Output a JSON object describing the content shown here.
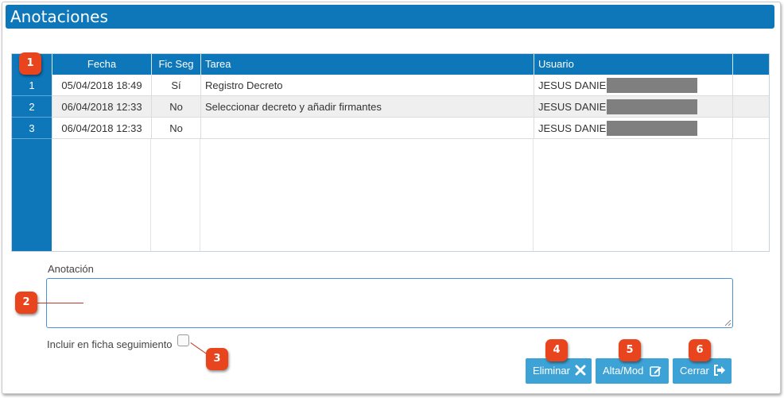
{
  "window": {
    "title": "Anotaciones"
  },
  "grid": {
    "columns": [
      "Fecha",
      "Fic Seg",
      "Tarea",
      "Usuario"
    ],
    "rows": [
      {
        "num": "1",
        "fecha": "05/04/2018 18:49",
        "fic_seg": "Sí",
        "tarea": "Registro Decreto",
        "usuario": "JESUS DANIEL"
      },
      {
        "num": "2",
        "fecha": "06/04/2018 12:33",
        "fic_seg": "No",
        "tarea": "Seleccionar decreto y añadir firmantes",
        "usuario": "JESUS DANIEL"
      },
      {
        "num": "3",
        "fecha": "06/04/2018 12:33",
        "fic_seg": "No",
        "tarea": "",
        "usuario": "JESUS DANIEL"
      }
    ]
  },
  "form": {
    "annotation_label": "Anotación",
    "annotation_value": "",
    "include_label": "Incluir en ficha seguimiento",
    "include_checked": false
  },
  "buttons": {
    "delete_label": "Eliminar",
    "save_label": "Alta/Mod",
    "close_label": "Cerrar"
  },
  "callouts": [
    "1",
    "2",
    "3",
    "4",
    "5",
    "6"
  ],
  "colors": {
    "primary": "#0d77b9",
    "button": "#3da3d6",
    "callout": "#e8441d",
    "redaction": "#7f7f7f"
  },
  "icons": {
    "delete": "close-icon",
    "save": "edit-icon",
    "close": "sign-out-icon"
  }
}
